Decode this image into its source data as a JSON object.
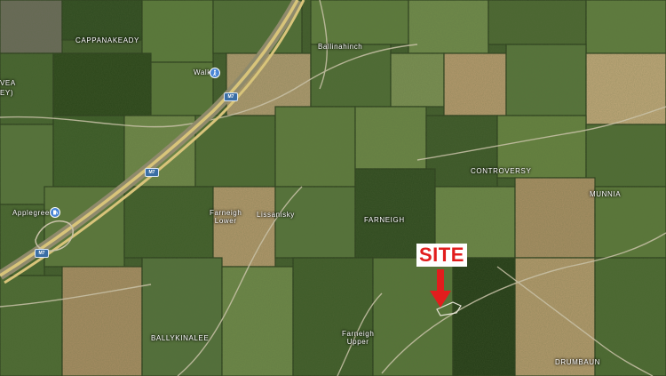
{
  "map": {
    "type": "satellite",
    "colors": {
      "field_dark": "#2f4a1f",
      "field_mid": "#4f6d35",
      "field_light": "#6f8a4a",
      "field_tan": "#b79a6e",
      "motorway": "#d8c47a",
      "road": "#c9c2a8",
      "site_red": "#e21d1d"
    }
  },
  "places": {
    "cappanakeady": "CAPPANAKEADY",
    "ballinahinch": "Ballinahinch",
    "walk": "Walk",
    "vea": "VEA",
    "ey": "EY)",
    "applegreen": "Applegreen",
    "controversy": "CONTROVERSY",
    "munnia": "MUNNIA",
    "farneigh": "FARNEIGH",
    "farneigh_lower_1": "Farneigh",
    "farneigh_lower_2": "Lower",
    "lissanisky": "Lissanisky",
    "farneigh_upper_1": "Farneigh",
    "farneigh_upper_2": "Upper",
    "ballykinalee": "BALLYKINALEE",
    "drumbaun": "DRUMBAUN"
  },
  "roads": {
    "m7_a": "M7",
    "m7_b": "M7",
    "m7_c": "M7"
  },
  "poi": {
    "walk_icon": "walking-icon",
    "applegreen_icon": "fuel-icon"
  },
  "site": {
    "label": "SITE"
  }
}
